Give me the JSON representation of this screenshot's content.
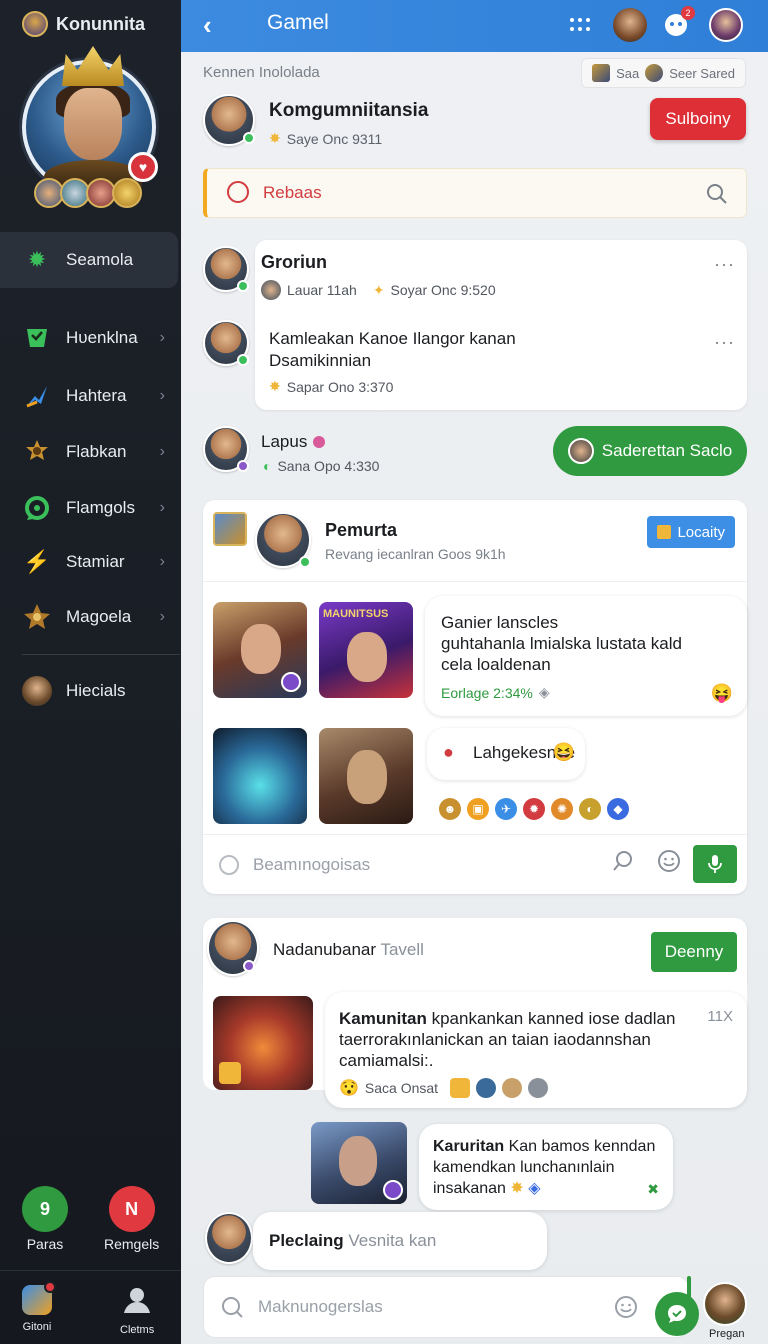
{
  "sidebar": {
    "brand": "Konunnita",
    "items": [
      {
        "label": "Seamola",
        "icon": "gear-icon",
        "color": "#3bbf5a"
      },
      {
        "label": "Hυenklna",
        "icon": "shield-icon",
        "color": "#3bbf5a"
      },
      {
        "label": "Hahtera",
        "icon": "pin-icon",
        "color": "#3a8ee6"
      },
      {
        "label": "Flabkan",
        "icon": "badge-icon",
        "color": "#d6a13a"
      },
      {
        "label": "Flamgols",
        "icon": "refresh-icon",
        "color": "#3bbf5a"
      },
      {
        "label": "Stamiar",
        "icon": "bolt-icon",
        "color": "#f0b63a"
      },
      {
        "label": "Magoela",
        "icon": "star-icon",
        "color": "#d6a13a"
      },
      {
        "label": "Hiecials",
        "icon": "avatar-icon",
        "color": "#d6a13a"
      }
    ],
    "bottom_buttons": [
      {
        "label": "Paras",
        "glyph": "9",
        "color": "#2f9a3f"
      },
      {
        "label": "Remgels",
        "glyph": "N",
        "color": "#e03a40"
      }
    ],
    "footer": [
      {
        "label": "Gitoni",
        "icon": "app-icon"
      },
      {
        "label": "Cletms",
        "icon": "user-icon"
      }
    ]
  },
  "topbar": {
    "title": "Gamel",
    "notification_count": "2"
  },
  "group": {
    "breadcrumb": "Kennen Inololada",
    "see_a": "Saa",
    "see_b": "Seer Sared",
    "name": "Komgumniitansia",
    "sub": "Saye Onc 9311",
    "subscribe_label": "Sulboiny"
  },
  "search": {
    "placeholder": "Rebaas"
  },
  "posts": [
    {
      "name": "Groriun",
      "meta_a": "Lauar 11ah",
      "meta_b": "Soyar Onc 9:520",
      "more": "···"
    },
    {
      "text_1": "Kamleakan Kanoe Ilangor kanan",
      "text_2": "Dsamikinnian",
      "meta": "Sapar Ono 3:370",
      "more": "···"
    },
    {
      "name": "Lapus",
      "meta": "Sana Opo 4:330",
      "action": "Saderettan Saclo"
    }
  ],
  "feature": {
    "title": "Pemurta",
    "sub": "Revang iecanlran Goos 9k1h",
    "tag": "Locaity",
    "thumb_label": "MAUNITSUS",
    "bubble_1_line_1": "Ganier lanscles",
    "bubble_1_line_2": "guhtahanla lmialska lustata kald",
    "bubble_1_line_3": "cela loaldenan",
    "bubble_1_meta": "Eorlage 2:34%",
    "bubble_2": "Lahgekesnde",
    "composer_placeholder": "Beamınogoisas"
  },
  "thread": {
    "name": "Nadanubanar",
    "name_suffix": "Tavell",
    "button": "Deenny",
    "msg_bold": "Kamunitan",
    "msg_rest_1": "kpankankan kanned iose dadlan",
    "msg_line_2": "taerrorakınlanickan an taian iaodannshan",
    "msg_line_3": "camiamalsi:.",
    "msg_count": "11X",
    "msg_meta": "Saca Onsat",
    "reply_bold": "Karuritan",
    "reply_rest": "Kan bamos kenndan",
    "reply_line_2": "kamendkan lunchanınlain",
    "reply_line_3": "insakanan",
    "last_name": "Pleclaing",
    "last_suffix": "Vesnita kan"
  },
  "composer": {
    "placeholder": "Maknunogerslas",
    "user_label": "Pregan"
  }
}
